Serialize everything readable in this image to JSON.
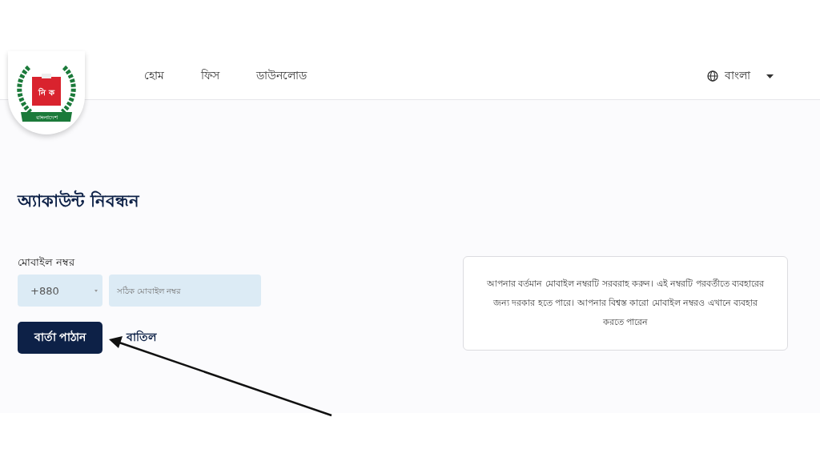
{
  "logo": {
    "box_text": "নি ক",
    "banner_text": "বাংলাদেশ"
  },
  "nav": [
    {
      "label": "হোম"
    },
    {
      "label": "ফিস"
    },
    {
      "label": "ডাউনলোড"
    }
  ],
  "language": {
    "label": "বাংলা"
  },
  "title": "অ্যাকাউন্ট নিবন্ধন",
  "phone": {
    "label": "মোবাইল নম্বর",
    "country_code": "+880",
    "placeholder": "সঠিক মোবাইল নম্বর"
  },
  "buttons": [
    {
      "label": "বার্তা পাঠান",
      "kind": "primary"
    },
    {
      "label": "বাতিল",
      "kind": "link"
    }
  ],
  "info": "আপনার বর্তমান মোবাইল নম্বরটি সরবরাহ করুন। এই নম্বরটি পরবর্তীতে ব্যবহারের জন্য দরকার হতে পারে। আপনার বিশ্বস্ত কারো মোবাইল নম্বরও এখানে ব্যবহার করতে পারেন"
}
